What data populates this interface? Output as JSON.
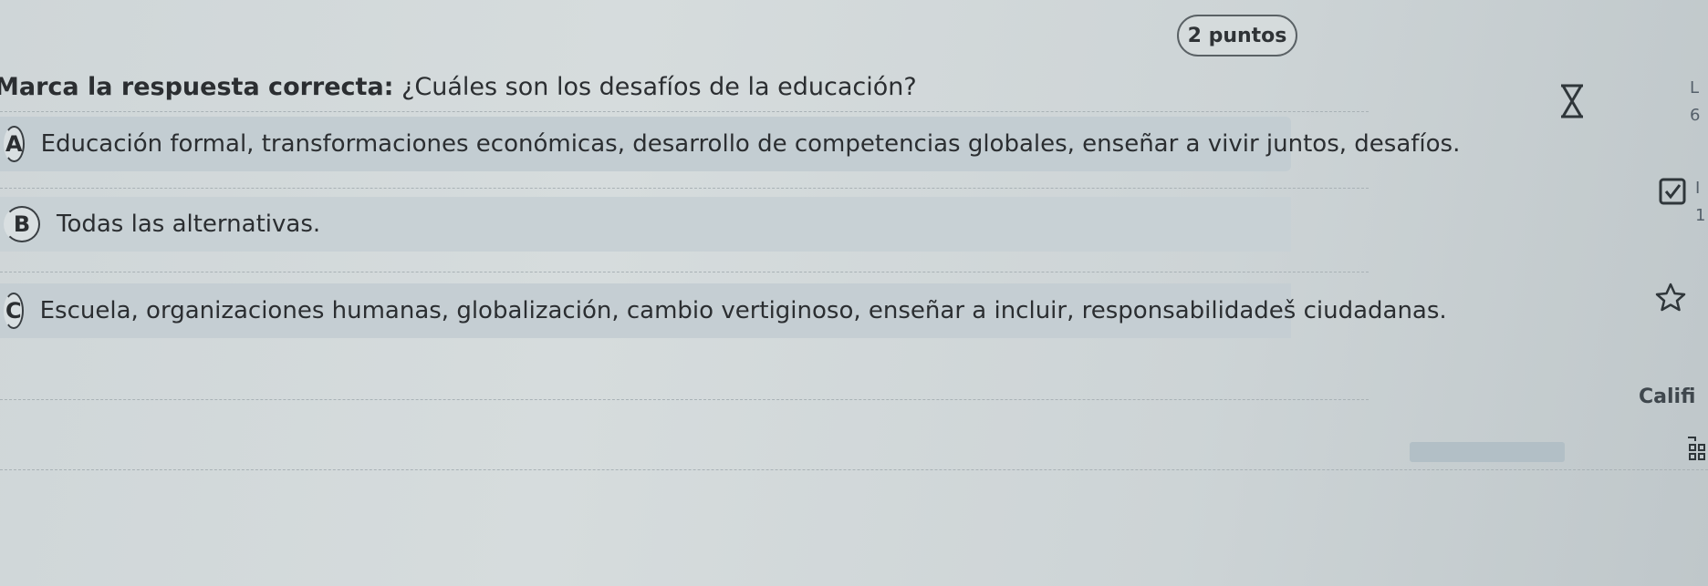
{
  "points_badge": "2 puntos",
  "question": {
    "label": "Marca la respuesta correcta:",
    "text": " ¿Cuáles son los desafíos de la educación?"
  },
  "options": [
    {
      "letter": "A",
      "text": "Educación formal, transformaciones económicas, desarrollo de competencias globales, enseñar a vivir juntos, desafíos."
    },
    {
      "letter": "B",
      "text": "Todas las alternativas."
    },
    {
      "letter": "C",
      "text": "Escuela, organizaciones humanas, globalización, cambio vertiginoso, enseñar a incluir, responsabilidadeš ciudadanas."
    }
  ],
  "side": {
    "timer_label": "L",
    "timer_value": "6",
    "check_label": "I",
    "check_value": "1",
    "calif_label": "Califi"
  },
  "icons": [
    "hourglass-icon",
    "checkbox-icon",
    "star-icon",
    "grid-icon"
  ]
}
